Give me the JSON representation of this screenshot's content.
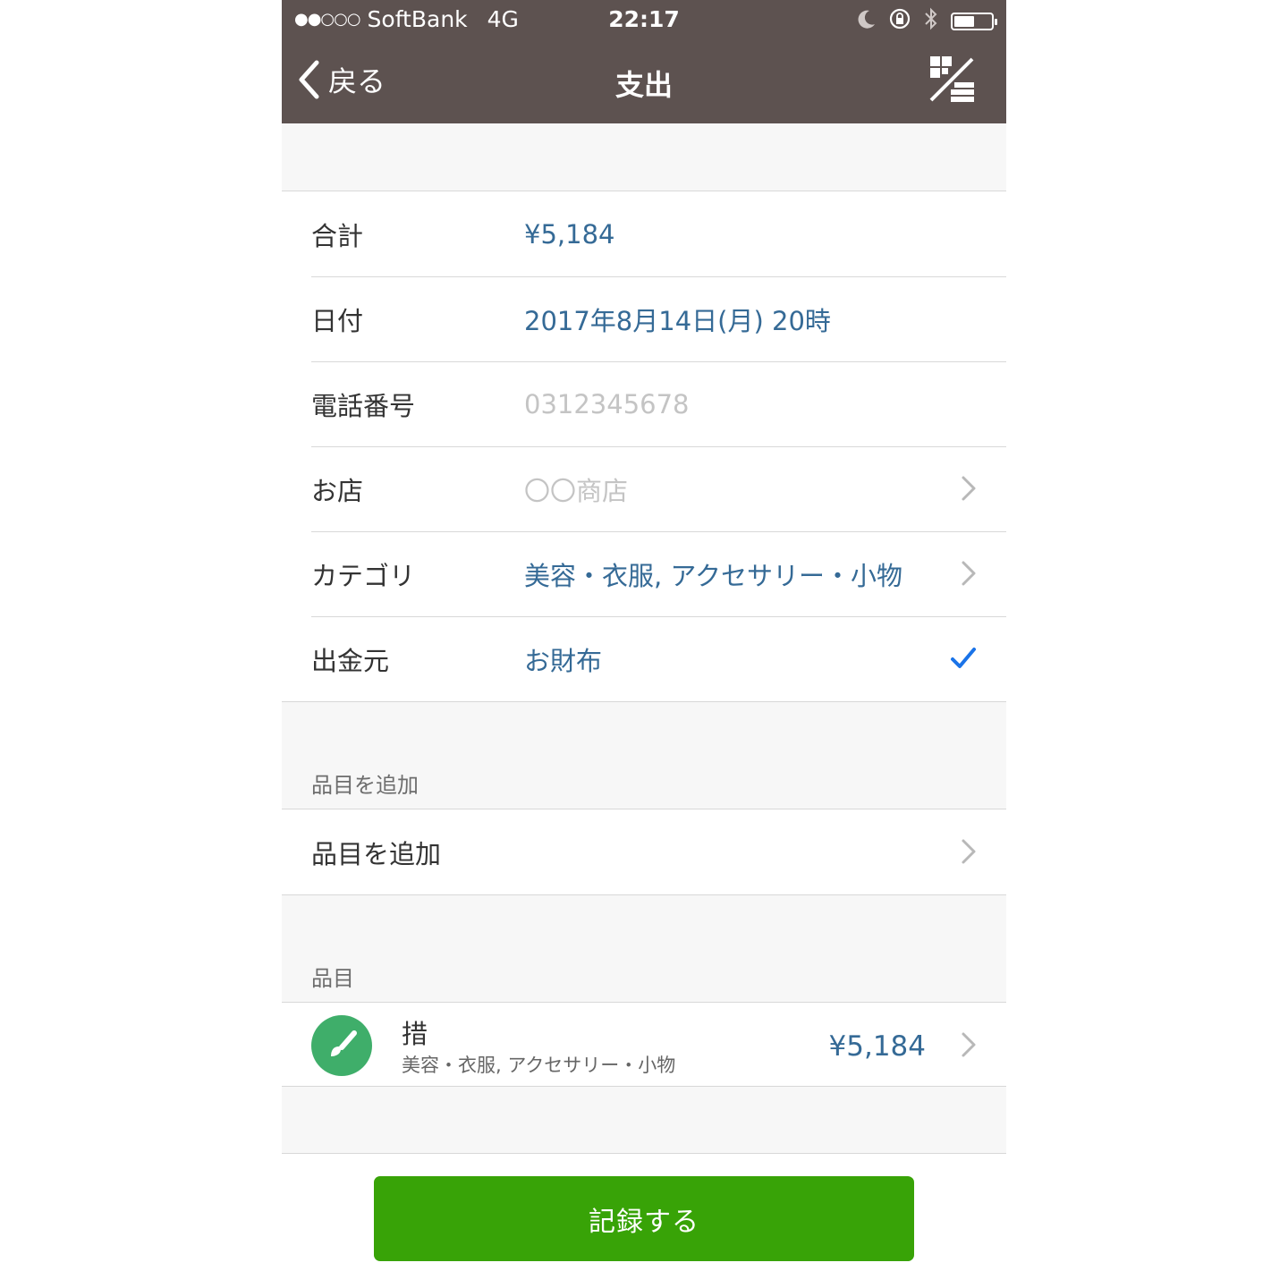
{
  "status_bar": {
    "signal": "●●○○○",
    "carrier": "SoftBank",
    "network": "4G",
    "time": "22:17",
    "battery_level": 0.55
  },
  "navbar": {
    "back_label": "戻る",
    "title": "支出",
    "action_icon": "split-grid-icon"
  },
  "form": {
    "total": {
      "label": "合計",
      "value": "¥5,184"
    },
    "date": {
      "label": "日付",
      "value": "2017年8月14日(月) 20時"
    },
    "phone": {
      "label": "電話番号",
      "placeholder": "0312345678"
    },
    "shop": {
      "label": "お店",
      "placeholder": "〇〇商店"
    },
    "category": {
      "label": "カテゴリ",
      "value": "美容・衣服, アクセサリー・小物"
    },
    "source": {
      "label": "出金元",
      "value": "お財布",
      "selected": true
    }
  },
  "add_item_section": {
    "header": "品目を追加",
    "row_label": "品目を追加"
  },
  "items_section": {
    "header": "品目",
    "items": [
      {
        "name": "措",
        "category": "美容・衣服, アクセサリー・小物",
        "amount": "¥5,184",
        "icon": "brush-icon",
        "icon_color": "#3fae6a"
      }
    ]
  },
  "footer": {
    "record_label": "記録する",
    "button_color": "#38a307"
  },
  "colors": {
    "header_bg": "#5d5250",
    "value_text": "#356a96",
    "check": "#1a73e8"
  }
}
